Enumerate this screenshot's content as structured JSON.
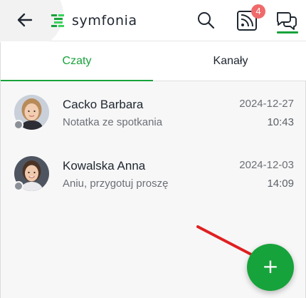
{
  "header": {
    "logo_text": "symfonia",
    "icons": [
      "back-arrow-icon",
      "symfonia-logo-icon",
      "search-icon",
      "rss-feed-icon",
      "chat-bubbles-icon"
    ],
    "feed_badge": "4",
    "accent_color": "#17a33b",
    "badge_color": "#ef6a6a"
  },
  "tabs": [
    {
      "label": "Czaty",
      "active": true
    },
    {
      "label": "Kanały",
      "active": false
    }
  ],
  "chats": [
    {
      "name": "Cacko Barbara",
      "preview": "Notatka ze spotkania",
      "date": "2024-12-27",
      "time": "10:43"
    },
    {
      "name": "Kowalska Anna",
      "preview": "Aniu, przygotuj proszę",
      "date": "2024-12-03",
      "time": "14:09"
    }
  ],
  "fab": {
    "icon": "plus-icon",
    "symbol": "+"
  },
  "annotation": {
    "icon": "red-arrow-icon",
    "color": "#e02020"
  }
}
